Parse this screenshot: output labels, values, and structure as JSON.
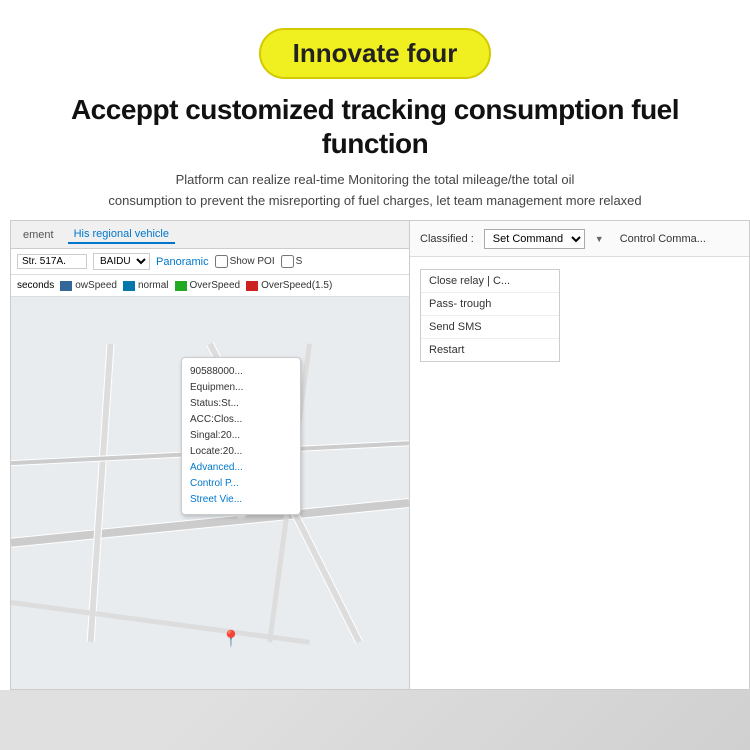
{
  "badge": {
    "text": "Innovate four"
  },
  "main_title": "Acceppt customized tracking consumption fuel function",
  "sub_text_line1": "Platform can realize real-time Monitoring  the total mileage/the total oil",
  "sub_text_line2": "consumption to prevent the misreporting of fuel charges, let team management more relaxed",
  "toolbar": {
    "tab1": "ement",
    "tab2": "His regional vehicle"
  },
  "map_controls": {
    "address": "Str. 517A.",
    "map_type": "BAIDU",
    "panoramic_link": "Panoramic",
    "show_poi": "Show POI",
    "s_label": "S"
  },
  "speed_legend": {
    "label": "seconds",
    "items": [
      {
        "label": "normal",
        "color": "#0088cc"
      },
      {
        "label": "OverSpeed",
        "color": "#22aa22"
      },
      {
        "label": "OverSpeed(1.5)",
        "color": "#cc2222"
      }
    ],
    "prefix": "owSpeed"
  },
  "popup": {
    "line1": "90588000...",
    "line2": "Equipmen...",
    "line3": "Status:St...",
    "line4": "ACC:Clos...",
    "line5": "Singal:20...",
    "line6": "Locate:20...",
    "link1": "Advanced...",
    "link2": "Control P...",
    "link3": "Street Vie..."
  },
  "right_panel": {
    "classified_label": "Classified :",
    "set_command": "Set Command",
    "control_cmd": "Control Comma...",
    "menu_items": [
      "Close relay  |  C...",
      "Pass- trough",
      "Send SMS",
      "Restart"
    ]
  }
}
